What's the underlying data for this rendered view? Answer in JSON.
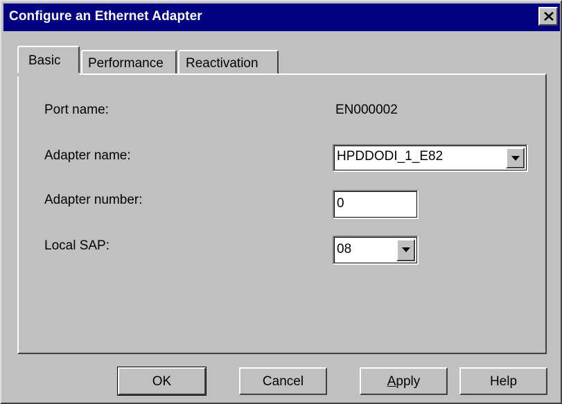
{
  "window": {
    "title": "Configure an Ethernet Adapter",
    "close_icon": "close-icon"
  },
  "tabs": [
    {
      "label": "Basic",
      "active": true
    },
    {
      "label": "Performance",
      "active": false
    },
    {
      "label": "Reactivation",
      "active": false
    }
  ],
  "basic": {
    "port_name_label": "Port name:",
    "port_name_value": "EN000002",
    "adapter_name_label": "Adapter name:",
    "adapter_name_value": "HPDDODI_1_E82",
    "adapter_number_label": "Adapter number:",
    "adapter_number_value": "0",
    "local_sap_label": "Local SAP:",
    "local_sap_value": "08"
  },
  "buttons": {
    "ok": "OK",
    "cancel": "Cancel",
    "apply_mnemonic": "A",
    "apply_rest": "pply",
    "help": "Help"
  },
  "colors": {
    "titlebar": "#000080",
    "face": "#c0c0c0"
  }
}
